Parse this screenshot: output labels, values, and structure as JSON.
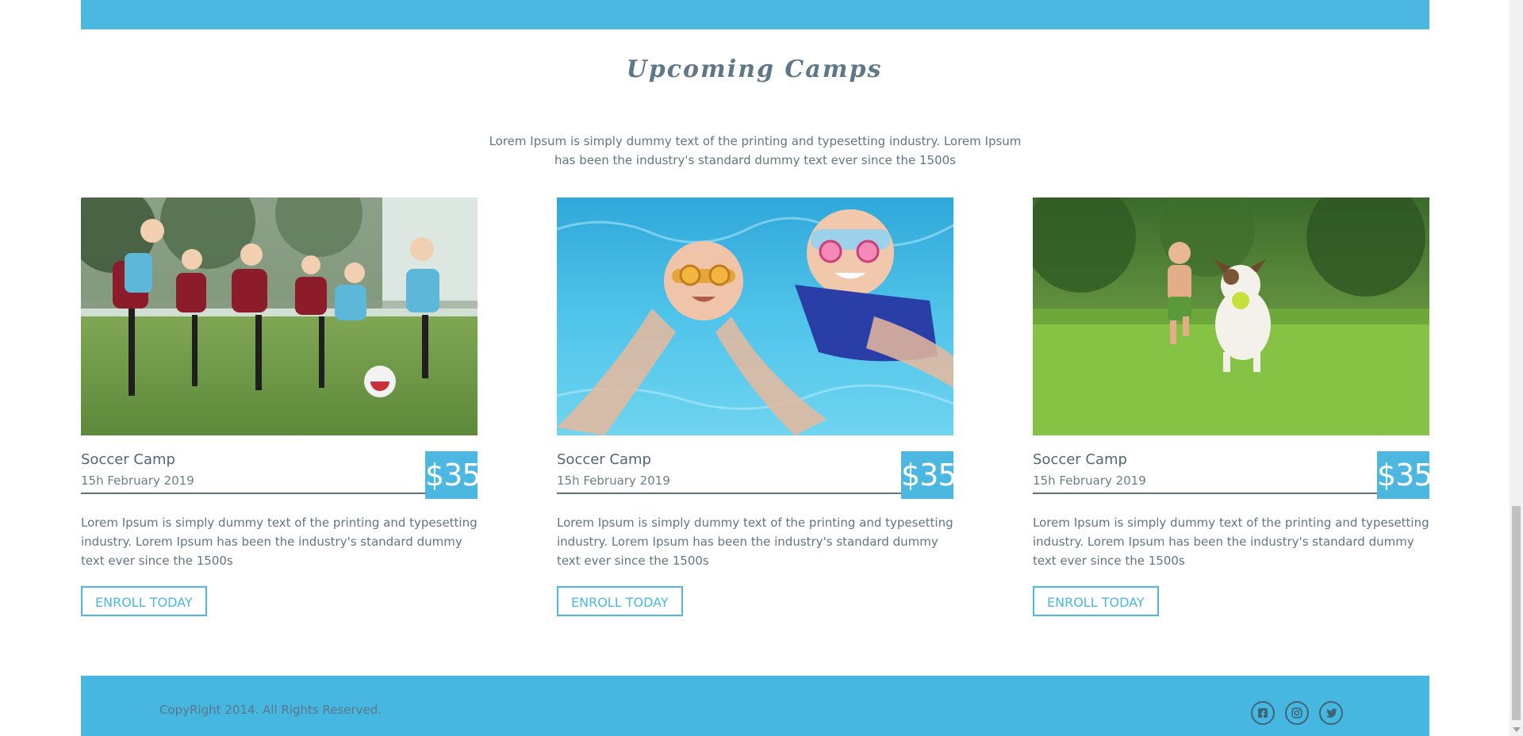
{
  "section": {
    "title": "Upcoming Camps",
    "intro": "Lorem Ipsum is simply dummy text of the printing and typesetting industry. Lorem Ipsum has been the industry's standard dummy text ever since the 1500s"
  },
  "cards": [
    {
      "title": "Soccer Camp",
      "date": "15h February 2019",
      "price": "$35",
      "text": "Lorem Ipsum is simply dummy text of the printing and typesetting industry. Lorem Ipsum has been the industry's standard dummy text ever since the 1500s",
      "button": "ENROLL TODAY",
      "photo": "kids-playing-soccer-photo"
    },
    {
      "title": "Soccer Camp",
      "date": "15h February 2019",
      "price": "$35",
      "text": "Lorem Ipsum is simply dummy text of the printing and typesetting industry. Lorem Ipsum has been the industry's standard dummy text ever since the 1500s",
      "button": "ENROLL TODAY",
      "photo": "kids-swimming-underwater-photo"
    },
    {
      "title": "Soccer Camp",
      "date": "15h February 2019",
      "price": "$35",
      "text": "Lorem Ipsum is simply dummy text of the printing and typesetting industry. Lorem Ipsum has been the industry's standard dummy text ever since the 1500s",
      "button": "ENROLL TODAY",
      "photo": "child-running-with-dog-photo"
    }
  ],
  "footer": {
    "copyright": "CopyRight 2014. All Rights Reserved.",
    "socials": [
      "facebook-icon",
      "instagram-icon",
      "twitter-icon"
    ]
  },
  "colors": {
    "accent": "#4cb8e2",
    "text": "#5b7383",
    "footer": "#46b7e1"
  }
}
